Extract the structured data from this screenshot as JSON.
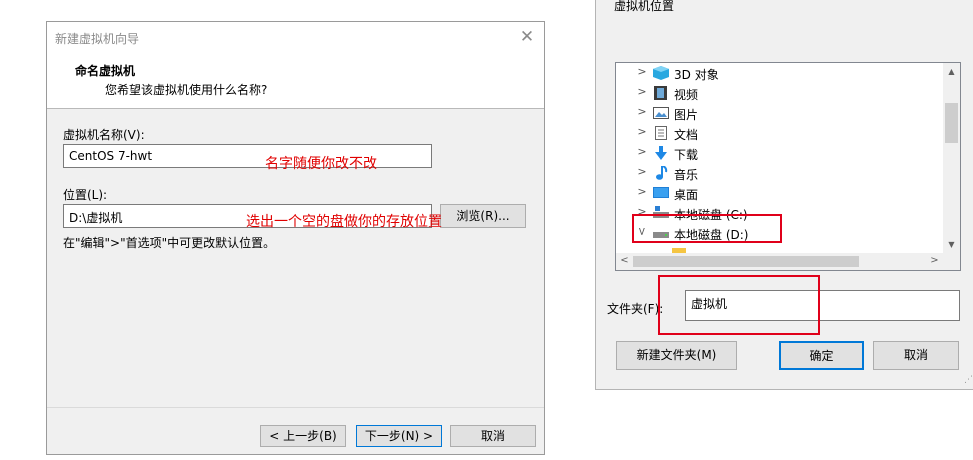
{
  "wizard": {
    "title": "新建虚拟机向导",
    "header_title": "命名虚拟机",
    "header_subtitle": "您希望该虚拟机使用什么名称?",
    "name_label": "虚拟机名称(V):",
    "name_value": "CentOS 7-hwt",
    "location_label": "位置(L):",
    "location_value": "D:\\虚拟机",
    "browse_label": "浏览(R)...",
    "hint": "在\"编辑\">\"首选项\"中可更改默认位置。",
    "back_label": "< 上一步(B)",
    "next_label": "下一步(N) >",
    "cancel_label": "取消"
  },
  "annotations": {
    "name_note": "名字随便你改不改",
    "location_note": "选出一个空的盘做你的存放位置"
  },
  "folder_dialog": {
    "title": "虚拟机位置",
    "tree": [
      {
        "label": "3D 对象",
        "icon": "3d-objects-icon",
        "expanded": false
      },
      {
        "label": "视频",
        "icon": "videos-icon",
        "expanded": false
      },
      {
        "label": "图片",
        "icon": "pictures-icon",
        "expanded": false
      },
      {
        "label": "文档",
        "icon": "documents-icon",
        "expanded": false
      },
      {
        "label": "下载",
        "icon": "downloads-icon",
        "expanded": false
      },
      {
        "label": "音乐",
        "icon": "music-icon",
        "expanded": false
      },
      {
        "label": "桌面",
        "icon": "desktop-icon",
        "expanded": false
      },
      {
        "label": "本地磁盘 (C:)",
        "icon": "drive-icon",
        "expanded": false
      },
      {
        "label": "本地磁盘 (D:)",
        "icon": "drive-icon",
        "expanded": true
      }
    ],
    "folder_label": "文件夹(F):",
    "folder_value": "虚拟机",
    "new_folder_label": "新建文件夹(M)",
    "ok_label": "确定",
    "cancel_label": "取消"
  },
  "colors": {
    "annotation": "#e00000",
    "primary_button_border": "#0078d7"
  }
}
